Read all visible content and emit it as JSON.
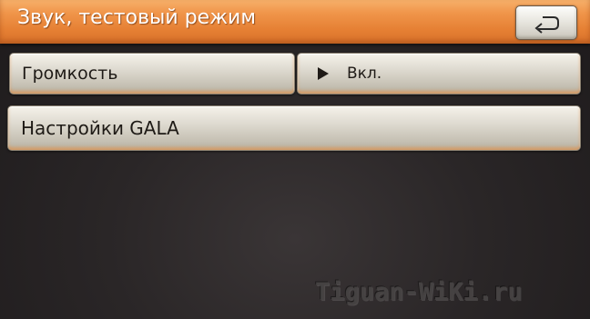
{
  "header": {
    "title": "Звук, тестовый режим",
    "back_icon": "return-arrow-icon"
  },
  "menu": {
    "volume_label": "Громкость",
    "volume_value": "Вкл.",
    "volume_value_icon": "play-triangle-icon",
    "gala_label": "Настройки GALA"
  },
  "watermark": {
    "text": "Tiguan-WiKi.ru"
  },
  "colors": {
    "header_orange": "#e8843a",
    "button_face": "#dedad0",
    "background": "#2a2627"
  }
}
